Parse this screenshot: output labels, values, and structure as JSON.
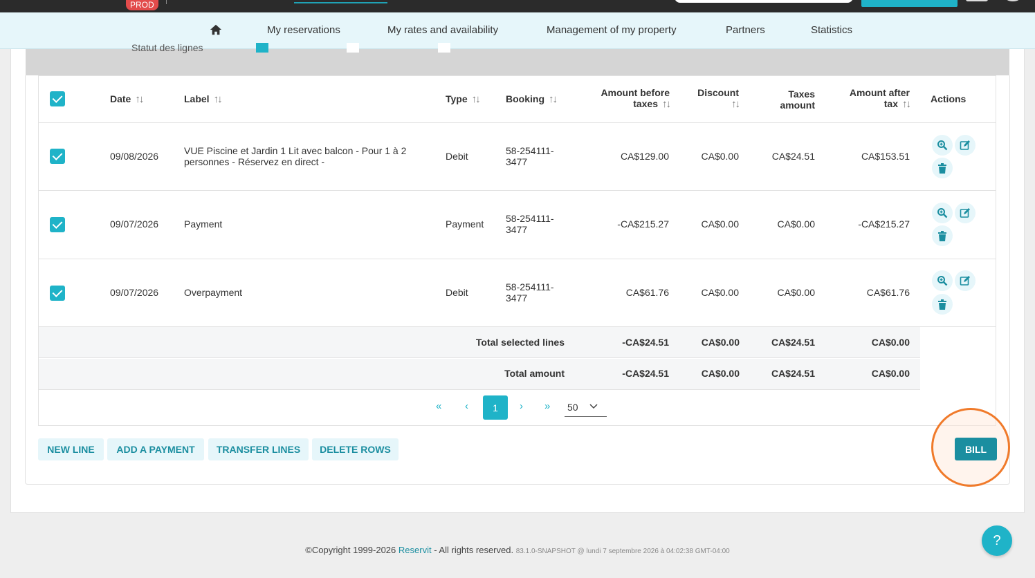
{
  "topbar": {
    "env_badge": "PROD"
  },
  "nav": {
    "items": [
      "My reservations",
      "My rates and availability",
      "Management of my property",
      "Partners",
      "Statistics"
    ]
  },
  "filters": {
    "label": "Statut des lignes"
  },
  "table": {
    "headers": {
      "date": "Date",
      "label": "Label",
      "type": "Type",
      "booking": "Booking",
      "amount_before_l1": "Amount before",
      "amount_before_l2": "taxes",
      "discount": "Discount",
      "taxes_l1": "Taxes",
      "taxes_l2": "amount",
      "amount_after_l1": "Amount after",
      "amount_after_l2": "tax",
      "actions": "Actions"
    },
    "rows": [
      {
        "date": "09/08/2026",
        "label_l1": "VUE Piscine et Jardin 1 Lit avec balcon - Pour 1 à 2",
        "label_l2": "personnes - Réservez en direct -",
        "type": "Debit",
        "booking_l1": "58-254111-",
        "booking_l2": "3477",
        "amount_before": "CA$129.00",
        "discount": "CA$0.00",
        "taxes": "CA$24.51",
        "amount_after": "CA$153.51"
      },
      {
        "date": "09/07/2026",
        "label_l1": "Payment",
        "label_l2": "",
        "type": "Payment",
        "booking_l1": "58-254111-",
        "booking_l2": "3477",
        "amount_before": "-CA$215.27",
        "discount": "CA$0.00",
        "taxes": "CA$0.00",
        "amount_after": "-CA$215.27"
      },
      {
        "date": "09/07/2026",
        "label_l1": "Overpayment",
        "label_l2": "",
        "type": "Debit",
        "booking_l1": "58-254111-",
        "booking_l2": "3477",
        "amount_before": "CA$61.76",
        "discount": "CA$0.00",
        "taxes": "CA$0.00",
        "amount_after": "CA$61.76"
      }
    ],
    "totals": [
      {
        "label": "Total selected lines",
        "amount_before": "-CA$24.51",
        "discount": "CA$0.00",
        "taxes": "CA$24.51",
        "amount_after": "CA$0.00"
      },
      {
        "label": "Total amount",
        "amount_before": "-CA$24.51",
        "discount": "CA$0.00",
        "taxes": "CA$24.51",
        "amount_after": "CA$0.00"
      }
    ]
  },
  "pagination": {
    "first": "«",
    "prev": "‹",
    "current": "1",
    "next": "›",
    "last": "»",
    "page_size": "50"
  },
  "buttons": {
    "new_line": "NEW LINE",
    "add_payment": "ADD A PAYMENT",
    "transfer_lines": "TRANSFER LINES",
    "delete_rows": "DELETE ROWS",
    "bill": "BILL"
  },
  "footer": {
    "copyright": "©Copyright 1999-2026",
    "brand": "Reservit",
    "rights": "- All rights reserved.",
    "version": "83.1.0-SNAPSHOT @ lundi 7 septembre 2026 à 04:02:38 GMT-04:00"
  },
  "help": {
    "label": "?"
  },
  "colors": {
    "accent": "#1fb3c8",
    "accent_dark": "#1b8ea0",
    "highlight": "#f07a2a",
    "badge": "#e24b4b"
  }
}
